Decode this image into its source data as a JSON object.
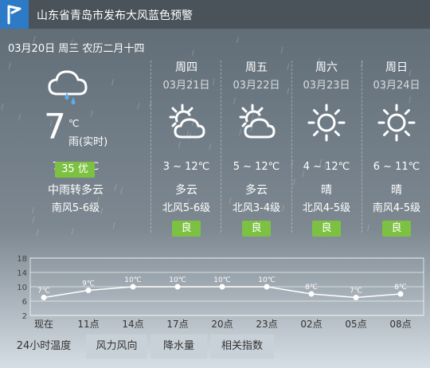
{
  "alert": {
    "text": "山东省青岛市发布大风蓝色预警",
    "icon": "flag-icon"
  },
  "date_line": "03月20日 周三 农历二月十四",
  "today": {
    "icon": "cloud-rain-icon",
    "temp": "7",
    "unit": "℃",
    "desc": "雨(实时)",
    "range": "7 ~ 11℃",
    "cond": "中雨转多云",
    "wind": "南风5-6级",
    "aqi_value": "35",
    "aqi_label": "优"
  },
  "forecast": [
    {
      "day": "周四",
      "date": "03月21日",
      "icon": "partly-cloudy-icon",
      "range": "3 ~ 12℃",
      "cond": "多云",
      "wind": "北风5-6级",
      "aqi": "良"
    },
    {
      "day": "周五",
      "date": "03月22日",
      "icon": "partly-cloudy-icon",
      "range": "5 ~ 12℃",
      "cond": "多云",
      "wind": "北风3-4级",
      "aqi": "良"
    },
    {
      "day": "周六",
      "date": "03月23日",
      "icon": "sun-icon",
      "range": "4 ~ 12℃",
      "cond": "晴",
      "wind": "北风4-5级",
      "aqi": "良"
    },
    {
      "day": "周日",
      "date": "03月24日",
      "icon": "sun-icon",
      "range": "6 ~ 11℃",
      "cond": "晴",
      "wind": "南风4-5级",
      "aqi": "良"
    }
  ],
  "chart_data": {
    "type": "line",
    "x": [
      "现在",
      "11点",
      "14点",
      "17点",
      "20点",
      "23点",
      "02点",
      "05点",
      "08点"
    ],
    "series": [
      {
        "values": [
          7,
          9,
          10,
          10,
          10,
          10,
          8,
          7,
          8
        ]
      }
    ],
    "point_labels": [
      "7℃",
      "9℃",
      "10℃",
      "10℃",
      "10℃",
      "10℃",
      "8℃",
      "7℃",
      "8℃"
    ],
    "yticks": [
      "18",
      "14",
      "10",
      "6",
      "2"
    ],
    "ylim": [
      2,
      18
    ],
    "grid": true
  },
  "tabs": [
    "24小时温度",
    "风力风向",
    "降水量",
    "相关指数"
  ],
  "colors": {
    "aqi_green": "#7dc142",
    "alert_blue": "#2d7bc7",
    "line": "#ffffff"
  }
}
